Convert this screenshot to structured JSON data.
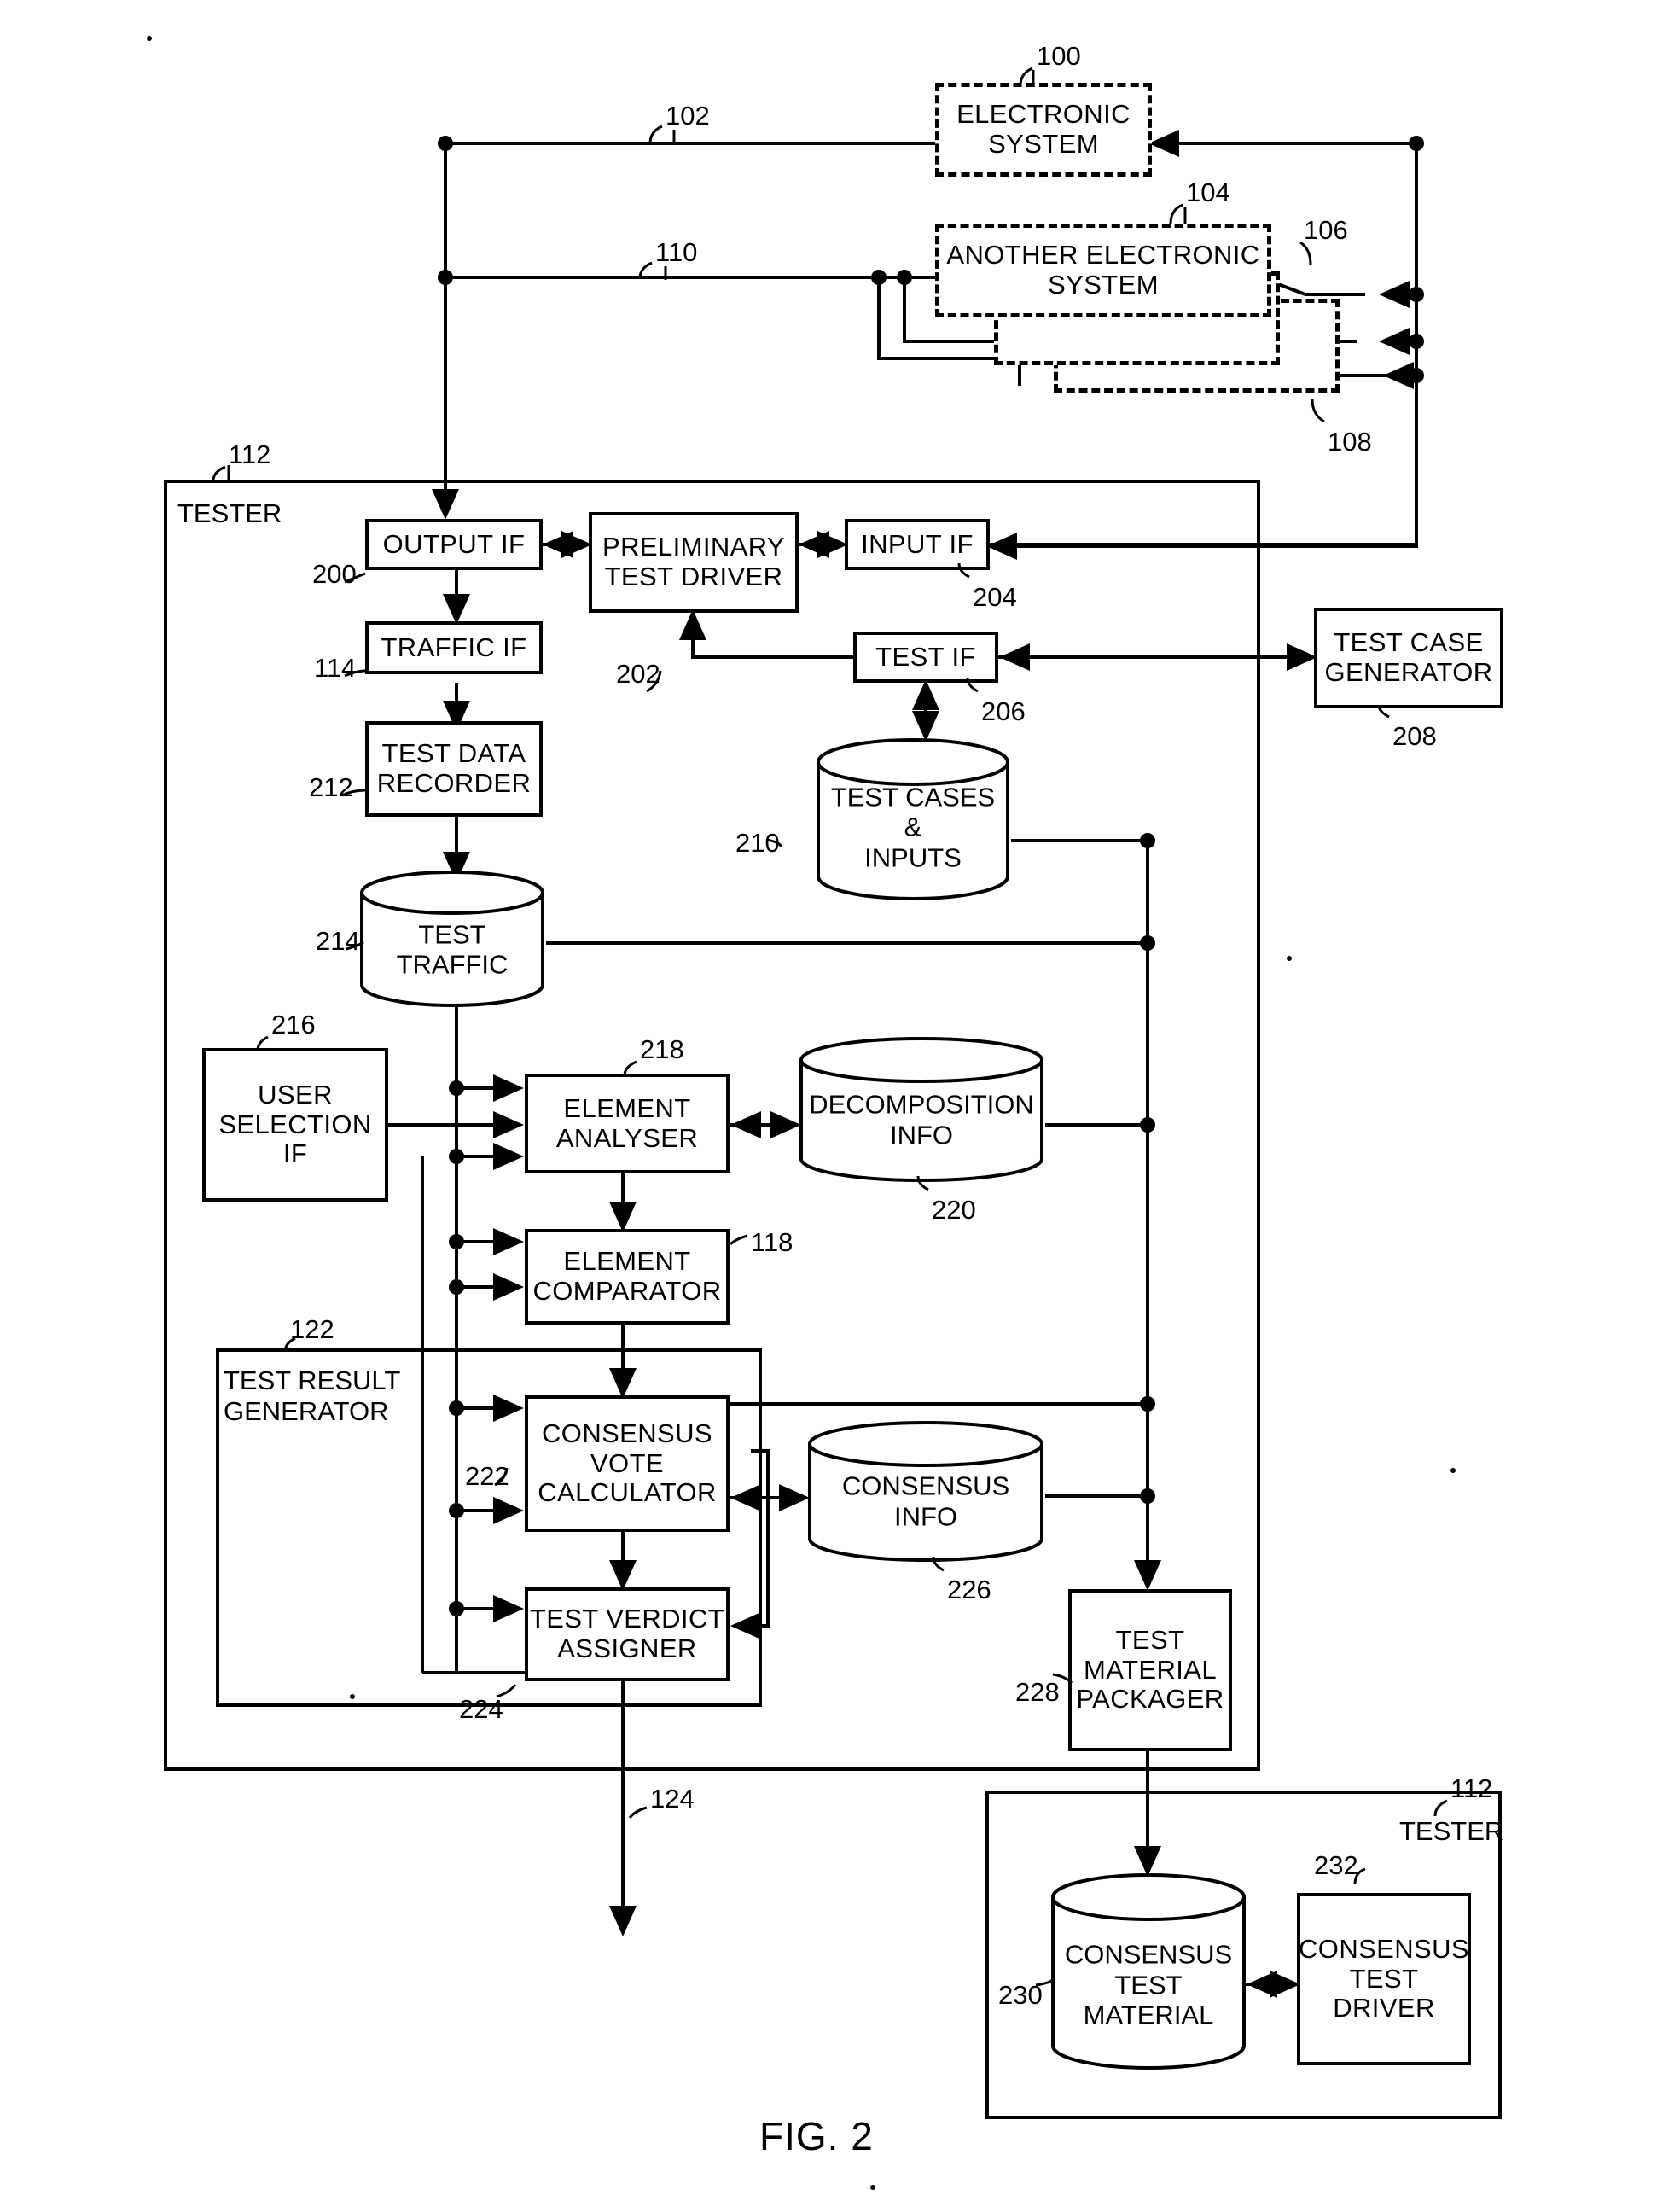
{
  "figure": {
    "caption": "FIG. 2",
    "title_blocks": {
      "tester_main": "TESTER",
      "tester_sub": "TESTER",
      "test_result_generator": "TEST RESULT\nGENERATOR"
    }
  },
  "nodes": [
    {
      "id": "electronic_system",
      "label": "ELECTRONIC\nSYSTEM",
      "ref": "100",
      "style": "dashed"
    },
    {
      "id": "another_electronic_system",
      "label": "ANOTHER ELECTRONIC\nSYSTEM",
      "ref": "104",
      "style": "dashed"
    },
    {
      "id": "hidden_system_106",
      "label": "",
      "ref": "106",
      "style": "dashed"
    },
    {
      "id": "hidden_system_108",
      "label": "",
      "ref": "108",
      "style": "dashed"
    },
    {
      "id": "output_if",
      "label": "OUTPUT IF",
      "ref": "200",
      "style": "box"
    },
    {
      "id": "preliminary_test_driver",
      "label": "PRELIMINARY\nTEST DRIVER",
      "ref": "202",
      "style": "box"
    },
    {
      "id": "input_if",
      "label": "INPUT IF",
      "ref": "204",
      "style": "box"
    },
    {
      "id": "traffic_if",
      "label": "TRAFFIC IF",
      "ref": "114",
      "style": "box"
    },
    {
      "id": "test_if",
      "label": "TEST IF",
      "ref": "206",
      "style": "box"
    },
    {
      "id": "test_case_generator",
      "label": "TEST CASE\nGENERATOR",
      "ref": "208",
      "style": "box"
    },
    {
      "id": "test_data_recorder",
      "label": "TEST DATA\nRECORDER",
      "ref": "212",
      "style": "box"
    },
    {
      "id": "test_cases_inputs",
      "label": "TEST CASES\n&\nINPUTS",
      "ref": "210",
      "style": "cylinder"
    },
    {
      "id": "test_traffic",
      "label": "TEST\nTRAFFIC",
      "ref": "214",
      "style": "cylinder"
    },
    {
      "id": "user_selection_if",
      "label": "USER\nSELECTION\nIF",
      "ref": "216",
      "style": "box"
    },
    {
      "id": "element_analyser",
      "label": "ELEMENT\nANALYSER",
      "ref": "218",
      "style": "box"
    },
    {
      "id": "decomposition_info",
      "label": "DECOMPOSITION\nINFO",
      "ref": "220",
      "style": "cylinder"
    },
    {
      "id": "element_comparator",
      "label": "ELEMENT\nCOMPARATOR",
      "ref": "118",
      "style": "box"
    },
    {
      "id": "test_result_generator",
      "label": "TEST RESULT\nGENERATOR",
      "ref": "122",
      "style": "box"
    },
    {
      "id": "consensus_vote_calculator",
      "label": "CONSENSUS\nVOTE\nCALCULATOR",
      "ref": "222",
      "style": "box"
    },
    {
      "id": "consensus_info",
      "label": "CONSENSUS\nINFO",
      "ref": "226",
      "style": "cylinder"
    },
    {
      "id": "test_verdict_assigner",
      "label": "TEST VERDICT\nASSIGNER",
      "ref": "224",
      "style": "box"
    },
    {
      "id": "test_material_packager",
      "label": "TEST\nMATERIAL\nPACKAGER",
      "ref": "228",
      "style": "box"
    },
    {
      "id": "consensus_test_material",
      "label": "CONSENSUS\nTEST\nMATERIAL",
      "ref": "230",
      "style": "cylinder"
    },
    {
      "id": "consensus_test_driver",
      "label": "CONSENSUS\nTEST\nDRIVER",
      "ref": "232",
      "style": "box"
    },
    {
      "id": "tester_outer",
      "label": "TESTER",
      "ref": "112",
      "style": "container"
    },
    {
      "id": "tester_inner",
      "label": "TESTER",
      "ref": "112",
      "style": "container"
    }
  ],
  "connector_refs": [
    "102",
    "110",
    "124"
  ],
  "labels": {
    "n100": "100",
    "n102": "102",
    "n104": "104",
    "n106": "106",
    "n108": "108",
    "n110": "110",
    "n112a": "112",
    "n112b": "112",
    "n114": "114",
    "n118": "118",
    "n122": "122",
    "n124": "124",
    "n200": "200",
    "n202": "202",
    "n204": "204",
    "n206": "206",
    "n208": "208",
    "n210": "210",
    "n212": "212",
    "n214": "214",
    "n216": "216",
    "n218": "218",
    "n220": "220",
    "n222": "222",
    "n224": "224",
    "n226": "226",
    "n228": "228",
    "n230": "230",
    "n232": "232"
  },
  "text": {
    "electronic_system_l1": "ELECTRONIC",
    "electronic_system_l2": "SYSTEM",
    "another_electronic_system_l1": "ANOTHER ELECTRONIC",
    "another_electronic_system_l2": "SYSTEM",
    "tester_main": "TESTER",
    "tester_sub": "TESTER",
    "output_if": "OUTPUT IF",
    "preliminary_test_driver_l1": "PRELIMINARY",
    "preliminary_test_driver_l2": "TEST DRIVER",
    "input_if": "INPUT IF",
    "traffic_if": "TRAFFIC IF",
    "test_if": "TEST IF",
    "test_case_generator_l1": "TEST CASE",
    "test_case_generator_l2": "GENERATOR",
    "test_data_recorder_l1": "TEST DATA",
    "test_data_recorder_l2": "RECORDER",
    "test_cases_inputs_l1": "TEST CASES",
    "test_cases_inputs_l2": "&",
    "test_cases_inputs_l3": "INPUTS",
    "test_traffic_l1": "TEST",
    "test_traffic_l2": "TRAFFIC",
    "user_selection_if_l1": "USER",
    "user_selection_if_l2": "SELECTION",
    "user_selection_if_l3": "IF",
    "element_analyser_l1": "ELEMENT",
    "element_analyser_l2": "ANALYSER",
    "decomposition_info_l1": "DECOMPOSITION",
    "decomposition_info_l2": "INFO",
    "element_comparator_l1": "ELEMENT",
    "element_comparator_l2": "COMPARATOR",
    "test_result_generator_l1": "TEST RESULT",
    "test_result_generator_l2": "GENERATOR",
    "consensus_vote_calculator_l1": "CONSENSUS",
    "consensus_vote_calculator_l2": "VOTE",
    "consensus_vote_calculator_l3": "CALCULATOR",
    "consensus_info_l1": "CONSENSUS",
    "consensus_info_l2": "INFO",
    "test_verdict_assigner_l1": "TEST VERDICT",
    "test_verdict_assigner_l2": "ASSIGNER",
    "test_material_packager_l1": "TEST",
    "test_material_packager_l2": "MATERIAL",
    "test_material_packager_l3": "PACKAGER",
    "consensus_test_material_l1": "CONSENSUS",
    "consensus_test_material_l2": "TEST",
    "consensus_test_material_l3": "MATERIAL",
    "consensus_test_driver_l1": "CONSENSUS",
    "consensus_test_driver_l2": "TEST",
    "consensus_test_driver_l3": "DRIVER",
    "figure_caption": "FIG. 2"
  }
}
